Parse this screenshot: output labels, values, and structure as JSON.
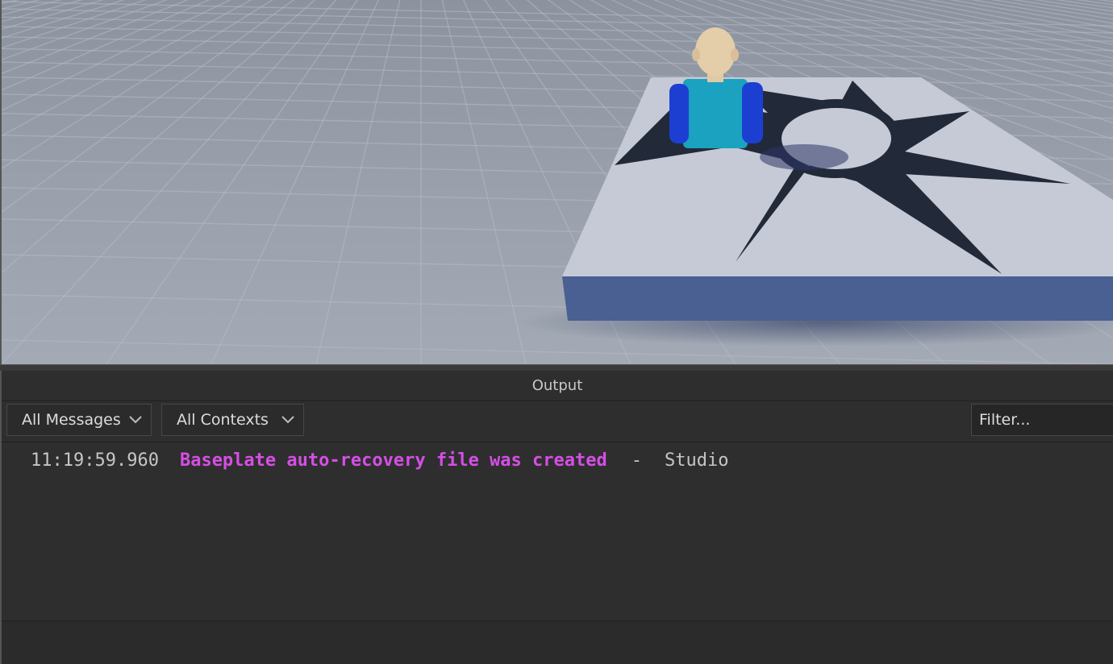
{
  "panel": {
    "title": "Output"
  },
  "toolbar": {
    "messages_filter": "All Messages",
    "contexts_filter": "All Contexts",
    "filter_placeholder": "Filter..."
  },
  "log": [
    {
      "timestamp": "11:19:59.960",
      "message": "Baseplate auto-recovery file was created",
      "separator": "-",
      "source": "Studio",
      "message_color": "#d64ee6"
    }
  ],
  "icons": {
    "dropdown": "chevron-down-icon"
  },
  "colors": {
    "panel_bg": "#2e2e2e",
    "message": "#d64ee6",
    "baseplate_top": "#c5cad6",
    "baseplate_side": "#4a5f92",
    "torso": "#1aa2c0",
    "arms": "#1c3fd2"
  }
}
